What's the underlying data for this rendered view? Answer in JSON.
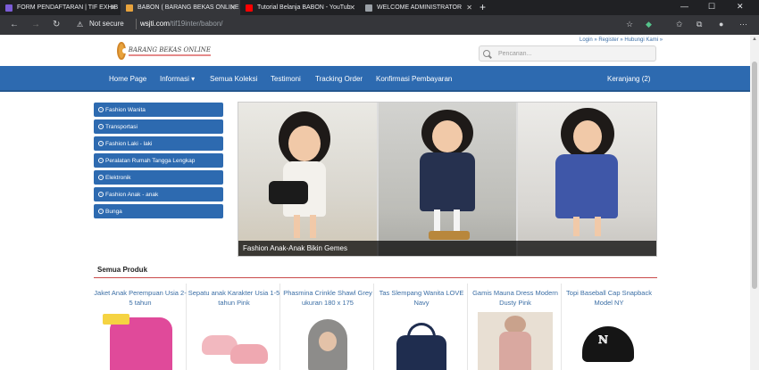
{
  "browser": {
    "tabs": [
      {
        "title": "FORM PENDAFTARAN | TIF EXHIB",
        "active": false,
        "favicon_color": "#7b5cd6"
      },
      {
        "title": "BABON ( BARANG BEKAS ONLINE",
        "active": true,
        "favicon_color": "#e8a33d"
      },
      {
        "title": "Tutorial Belanja BABON - YouTub",
        "active": false,
        "favicon_color": "#ff0000"
      },
      {
        "title": "WELCOME ADMINISTRATOR",
        "active": false,
        "favicon_color": "#9aa0a6"
      }
    ],
    "new_tab_glyph": "+",
    "security_label": "Not secure",
    "url_host": "wsjti.com",
    "url_path": "/tif19inter/babon/"
  },
  "site": {
    "logo_text": "BARANG BEKAS ONLINE",
    "top_links": "Login » Register » Hubungi Kami »",
    "search_placeholder": "Pencarian...",
    "nav": {
      "home": "Home Page",
      "info": "Informasi ▾",
      "collections": "Semua Koleksi",
      "testimonials": "Testimoni",
      "tracking": "Tracking Order",
      "payment": "Konfirmasi Pembayaran",
      "cart": "Keranjang (2)"
    },
    "categories": [
      "Fashion Wanita",
      "Transportasi",
      "Fashion Laki - laki",
      "Peralatan Rumah Tangga Lengkap",
      "Elektronik",
      "Fashion Anak - anak",
      "Bunga"
    ],
    "carousel_caption": "Fashion Anak-Anak Bikin Gemes",
    "products_title": "Semua Produk",
    "products": [
      {
        "name": "Jaket Anak Perempuan Usia 2-5 tahun",
        "image_color": "#e04a9a"
      },
      {
        "name": "Sepatu anak Karakter Usia 1-5 tahun Pink",
        "image_color": "#f2b8bf"
      },
      {
        "name": "Phasmina Crinkle Shawl Grey ukuran 180 x 175",
        "image_color": "#8d8c8a"
      },
      {
        "name": "Tas Slempang Wanita LOVE Navy",
        "image_color": "#1f2d4f"
      },
      {
        "name": "Gamis Mauna Dress Modern Dusty Pink",
        "image_color": "#d9a8a0"
      },
      {
        "name": "Topi Baseball Cap Snapback Model NY",
        "image_color": "#151515"
      }
    ]
  },
  "colors": {
    "brand_blue": "#2d6ab0",
    "link_blue": "#3b6ea5",
    "accent_red": "#c94a4a",
    "chrome_dark": "#202124"
  }
}
